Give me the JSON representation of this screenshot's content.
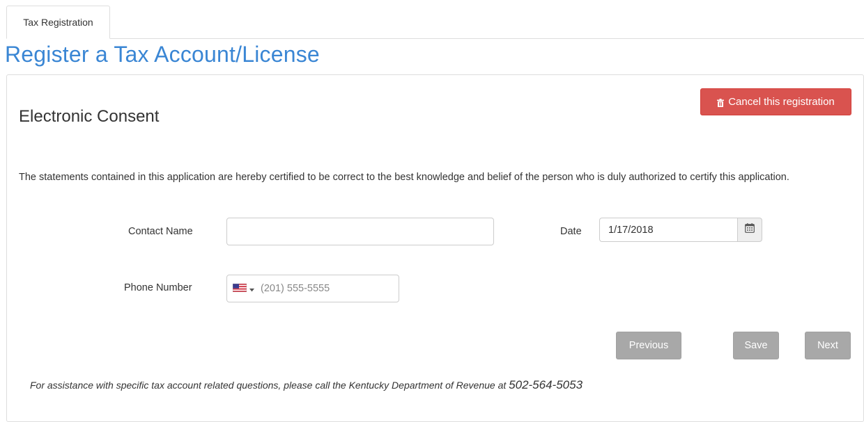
{
  "tabs": [
    {
      "label": "Tax Registration"
    }
  ],
  "page": {
    "title": "Register a Tax Account/License"
  },
  "actions": {
    "cancel_label": "Cancel this registration"
  },
  "section": {
    "title": "Electronic Consent",
    "statement": "The statements contained in this application are hereby certified to be correct to the best knowledge and belief of the person who is duly authorized to certify this application."
  },
  "form": {
    "contact_name": {
      "label": "Contact Name",
      "value": ""
    },
    "date": {
      "label": "Date",
      "value": "1/17/2018"
    },
    "phone": {
      "label": "Phone Number",
      "placeholder": "(201) 555-5555",
      "country": "us-flag-icon"
    }
  },
  "navigation": {
    "previous": "Previous",
    "save": "Save",
    "next": "Next"
  },
  "footer": {
    "text": "For assistance with specific tax account related questions, please call the Kentucky Department of Revenue at",
    "phone": "502-564-5053"
  },
  "colors": {
    "title": "#3a86d4",
    "danger": "#d9534f",
    "disabled_button": "#a8a8a8"
  }
}
